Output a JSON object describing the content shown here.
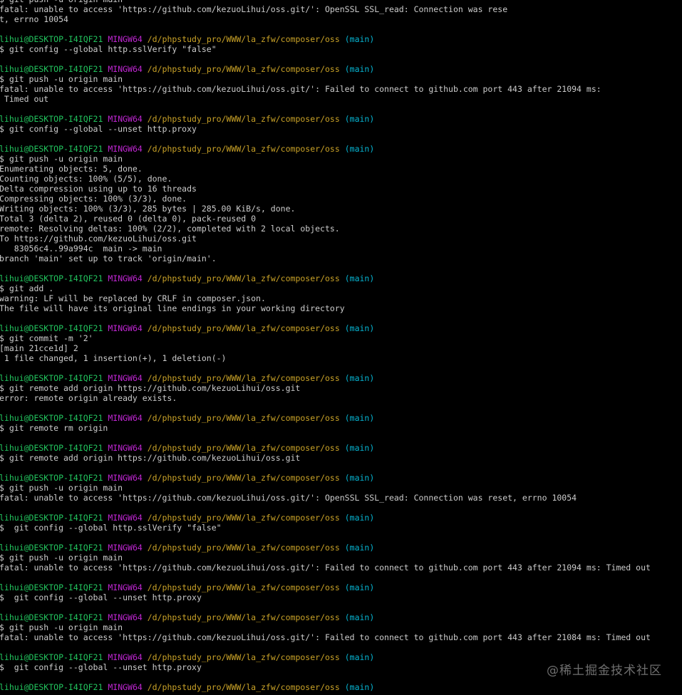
{
  "terminal": {
    "colors": {
      "background": "#000000",
      "text": "#cccccc",
      "user": "#22c55e",
      "host": "#c026d3",
      "path": "#c9a227",
      "branch": "#06b6d4"
    },
    "lines": [
      {
        "kind": "command",
        "text": "$ git push -u origin main"
      },
      {
        "kind": "output",
        "text": "fatal: unable to access 'https://github.com/kezuoLihui/oss.git/': OpenSSL SSL_read: Connection was rese"
      },
      {
        "kind": "output",
        "text": "t, errno 10054"
      },
      {
        "kind": "blank",
        "text": ""
      },
      {
        "kind": "prompt",
        "user": "lihui@DESKTOP-I4IQF21",
        "host": "MINGW64",
        "path": "/d/phpstudy_pro/WWW/la_zfw/composer/oss",
        "branch": "(main)"
      },
      {
        "kind": "command",
        "text": "$ git config --global http.sslVerify \"false\""
      },
      {
        "kind": "blank",
        "text": ""
      },
      {
        "kind": "prompt",
        "user": "lihui@DESKTOP-I4IQF21",
        "host": "MINGW64",
        "path": "/d/phpstudy_pro/WWW/la_zfw/composer/oss",
        "branch": "(main)"
      },
      {
        "kind": "command",
        "text": "$ git push -u origin main"
      },
      {
        "kind": "output",
        "text": "fatal: unable to access 'https://github.com/kezuoLihui/oss.git/': Failed to connect to github.com port 443 after 21094 ms:"
      },
      {
        "kind": "output",
        "text": " Timed out"
      },
      {
        "kind": "blank",
        "text": ""
      },
      {
        "kind": "prompt",
        "user": "lihui@DESKTOP-I4IQF21",
        "host": "MINGW64",
        "path": "/d/phpstudy_pro/WWW/la_zfw/composer/oss",
        "branch": "(main)"
      },
      {
        "kind": "command",
        "text": "$ git config --global --unset http.proxy"
      },
      {
        "kind": "blank",
        "text": ""
      },
      {
        "kind": "prompt",
        "user": "lihui@DESKTOP-I4IQF21",
        "host": "MINGW64",
        "path": "/d/phpstudy_pro/WWW/la_zfw/composer/oss",
        "branch": "(main)"
      },
      {
        "kind": "command",
        "text": "$ git push -u origin main"
      },
      {
        "kind": "output",
        "text": "Enumerating objects: 5, done."
      },
      {
        "kind": "output",
        "text": "Counting objects: 100% (5/5), done."
      },
      {
        "kind": "output",
        "text": "Delta compression using up to 16 threads"
      },
      {
        "kind": "output",
        "text": "Compressing objects: 100% (3/3), done."
      },
      {
        "kind": "output",
        "text": "Writing objects: 100% (3/3), 285 bytes | 285.00 KiB/s, done."
      },
      {
        "kind": "output",
        "text": "Total 3 (delta 2), reused 0 (delta 0), pack-reused 0"
      },
      {
        "kind": "output",
        "text": "remote: Resolving deltas: 100% (2/2), completed with 2 local objects."
      },
      {
        "kind": "output",
        "text": "To https://github.com/kezuoLihui/oss.git"
      },
      {
        "kind": "output",
        "text": "   83056c4..99a994c  main -> main"
      },
      {
        "kind": "output",
        "text": "branch 'main' set up to track 'origin/main'."
      },
      {
        "kind": "blank",
        "text": ""
      },
      {
        "kind": "prompt",
        "user": "lihui@DESKTOP-I4IQF21",
        "host": "MINGW64",
        "path": "/d/phpstudy_pro/WWW/la_zfw/composer/oss",
        "branch": "(main)"
      },
      {
        "kind": "command",
        "text": "$ git add ."
      },
      {
        "kind": "output",
        "text": "warning: LF will be replaced by CRLF in composer.json."
      },
      {
        "kind": "output",
        "text": "The file will have its original line endings in your working directory"
      },
      {
        "kind": "blank",
        "text": ""
      },
      {
        "kind": "prompt",
        "user": "lihui@DESKTOP-I4IQF21",
        "host": "MINGW64",
        "path": "/d/phpstudy_pro/WWW/la_zfw/composer/oss",
        "branch": "(main)"
      },
      {
        "kind": "command",
        "text": "$ git commit -m '2'"
      },
      {
        "kind": "output",
        "text": "[main 21cce1d] 2"
      },
      {
        "kind": "output",
        "text": " 1 file changed, 1 insertion(+), 1 deletion(-)"
      },
      {
        "kind": "blank",
        "text": ""
      },
      {
        "kind": "prompt",
        "user": "lihui@DESKTOP-I4IQF21",
        "host": "MINGW64",
        "path": "/d/phpstudy_pro/WWW/la_zfw/composer/oss",
        "branch": "(main)"
      },
      {
        "kind": "command",
        "text": "$ git remote add origin https://github.com/kezuoLihui/oss.git"
      },
      {
        "kind": "output",
        "text": "error: remote origin already exists."
      },
      {
        "kind": "blank",
        "text": ""
      },
      {
        "kind": "prompt",
        "user": "lihui@DESKTOP-I4IQF21",
        "host": "MINGW64",
        "path": "/d/phpstudy_pro/WWW/la_zfw/composer/oss",
        "branch": "(main)"
      },
      {
        "kind": "command",
        "text": "$ git remote rm origin"
      },
      {
        "kind": "blank",
        "text": ""
      },
      {
        "kind": "prompt",
        "user": "lihui@DESKTOP-I4IQF21",
        "host": "MINGW64",
        "path": "/d/phpstudy_pro/WWW/la_zfw/composer/oss",
        "branch": "(main)"
      },
      {
        "kind": "command",
        "text": "$ git remote add origin https://github.com/kezuoLihui/oss.git"
      },
      {
        "kind": "blank",
        "text": ""
      },
      {
        "kind": "prompt",
        "user": "lihui@DESKTOP-I4IQF21",
        "host": "MINGW64",
        "path": "/d/phpstudy_pro/WWW/la_zfw/composer/oss",
        "branch": "(main)"
      },
      {
        "kind": "command",
        "text": "$ git push -u origin main"
      },
      {
        "kind": "output",
        "text": "fatal: unable to access 'https://github.com/kezuoLihui/oss.git/': OpenSSL SSL_read: Connection was reset, errno 10054"
      },
      {
        "kind": "blank",
        "text": ""
      },
      {
        "kind": "prompt",
        "user": "lihui@DESKTOP-I4IQF21",
        "host": "MINGW64",
        "path": "/d/phpstudy_pro/WWW/la_zfw/composer/oss",
        "branch": "(main)"
      },
      {
        "kind": "command",
        "text": "$  git config --global http.sslVerify \"false\""
      },
      {
        "kind": "blank",
        "text": ""
      },
      {
        "kind": "prompt",
        "user": "lihui@DESKTOP-I4IQF21",
        "host": "MINGW64",
        "path": "/d/phpstudy_pro/WWW/la_zfw/composer/oss",
        "branch": "(main)"
      },
      {
        "kind": "command",
        "text": "$ git push -u origin main"
      },
      {
        "kind": "output",
        "text": "fatal: unable to access 'https://github.com/kezuoLihui/oss.git/': Failed to connect to github.com port 443 after 21094 ms: Timed out"
      },
      {
        "kind": "blank",
        "text": ""
      },
      {
        "kind": "prompt",
        "user": "lihui@DESKTOP-I4IQF21",
        "host": "MINGW64",
        "path": "/d/phpstudy_pro/WWW/la_zfw/composer/oss",
        "branch": "(main)"
      },
      {
        "kind": "command",
        "text": "$  git config --global --unset http.proxy"
      },
      {
        "kind": "blank",
        "text": ""
      },
      {
        "kind": "prompt",
        "user": "lihui@DESKTOP-I4IQF21",
        "host": "MINGW64",
        "path": "/d/phpstudy_pro/WWW/la_zfw/composer/oss",
        "branch": "(main)"
      },
      {
        "kind": "command",
        "text": "$ git push -u origin main"
      },
      {
        "kind": "output",
        "text": "fatal: unable to access 'https://github.com/kezuoLihui/oss.git/': Failed to connect to github.com port 443 after 21084 ms: Timed out"
      },
      {
        "kind": "blank",
        "text": ""
      },
      {
        "kind": "prompt",
        "user": "lihui@DESKTOP-I4IQF21",
        "host": "MINGW64",
        "path": "/d/phpstudy_pro/WWW/la_zfw/composer/oss",
        "branch": "(main)"
      },
      {
        "kind": "command",
        "text": "$  git config --global --unset http.proxy"
      },
      {
        "kind": "blank",
        "text": ""
      },
      {
        "kind": "prompt",
        "user": "lihui@DESKTOP-I4IQF21",
        "host": "MINGW64",
        "path": "/d/phpstudy_pro/WWW/la_zfw/composer/oss",
        "branch": "(main)"
      }
    ]
  },
  "watermark": {
    "text": "@稀土掘金技术社区"
  }
}
